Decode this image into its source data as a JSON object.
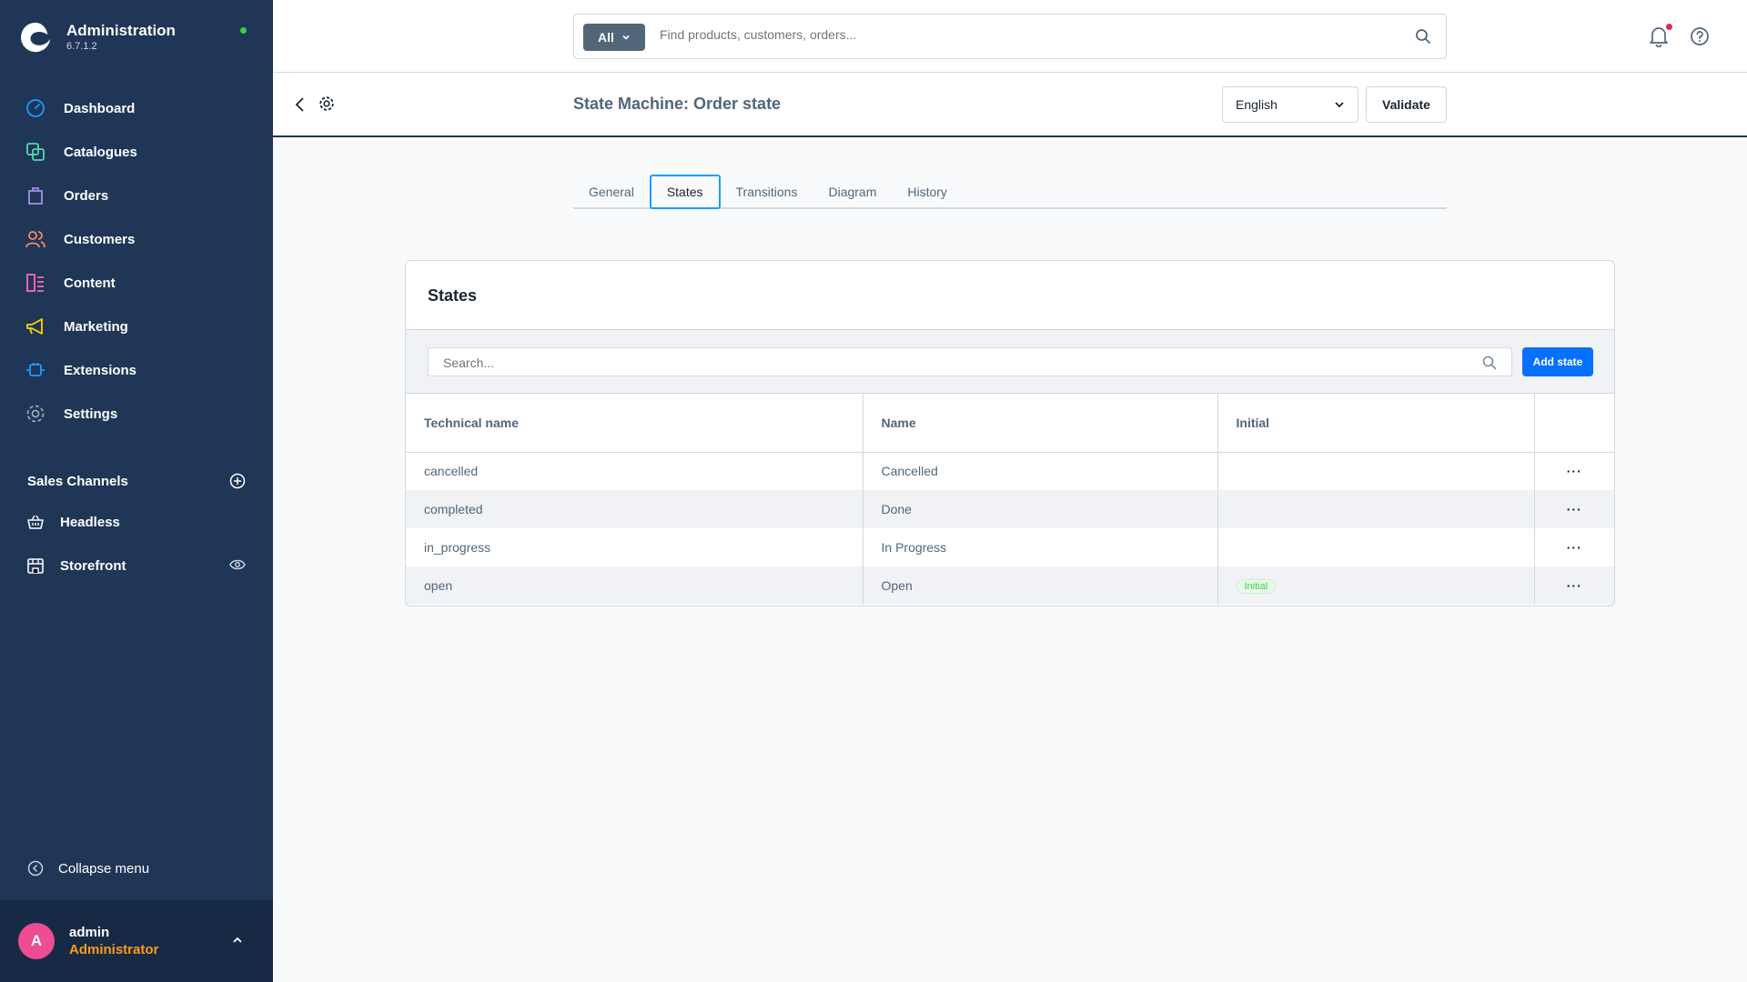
{
  "app": {
    "title": "Administration",
    "version": "6.7.1.2"
  },
  "sidebar": {
    "items": [
      {
        "label": "Dashboard",
        "icon": "dashboard-icon"
      },
      {
        "label": "Catalogues",
        "icon": "catalogues-icon"
      },
      {
        "label": "Orders",
        "icon": "orders-icon"
      },
      {
        "label": "Customers",
        "icon": "customers-icon"
      },
      {
        "label": "Content",
        "icon": "content-icon"
      },
      {
        "label": "Marketing",
        "icon": "marketing-icon"
      },
      {
        "label": "Extensions",
        "icon": "extensions-icon"
      },
      {
        "label": "Settings",
        "icon": "settings-icon"
      }
    ],
    "sales_channels_title": "Sales Channels",
    "sales_channels": [
      {
        "label": "Headless",
        "icon": "basket-icon"
      },
      {
        "label": "Storefront",
        "icon": "storefront-icon"
      }
    ],
    "collapse_label": "Collapse menu",
    "user": {
      "initial": "A",
      "name": "admin",
      "role": "Administrator"
    }
  },
  "header": {
    "search_scope": "All",
    "search_placeholder": "Find products, customers, orders..."
  },
  "page": {
    "title": "State Machine: Order state",
    "language": "English",
    "validate_label": "Validate"
  },
  "tabs": [
    {
      "label": "General",
      "active": false
    },
    {
      "label": "States",
      "active": true
    },
    {
      "label": "Transitions",
      "active": false
    },
    {
      "label": "Diagram",
      "active": false
    },
    {
      "label": "History",
      "active": false
    }
  ],
  "states_card": {
    "title": "States",
    "search_placeholder": "Search...",
    "add_label": "Add state",
    "columns": [
      "Technical name",
      "Name",
      "Initial"
    ],
    "rows": [
      {
        "technical_name": "cancelled",
        "name": "Cancelled",
        "initial": ""
      },
      {
        "technical_name": "completed",
        "name": "Done",
        "initial": ""
      },
      {
        "technical_name": "in_progress",
        "name": "In Progress",
        "initial": ""
      },
      {
        "technical_name": "open",
        "name": "Open",
        "initial": "Initial"
      }
    ],
    "actions_label": "···"
  },
  "colors": {
    "sidebar_bg": "#1f3657",
    "primary": "#0870ff",
    "tab_active": "#189eff",
    "status_online": "#37d046",
    "avatar": "#ee4c93",
    "role": "#ff9a1e"
  }
}
